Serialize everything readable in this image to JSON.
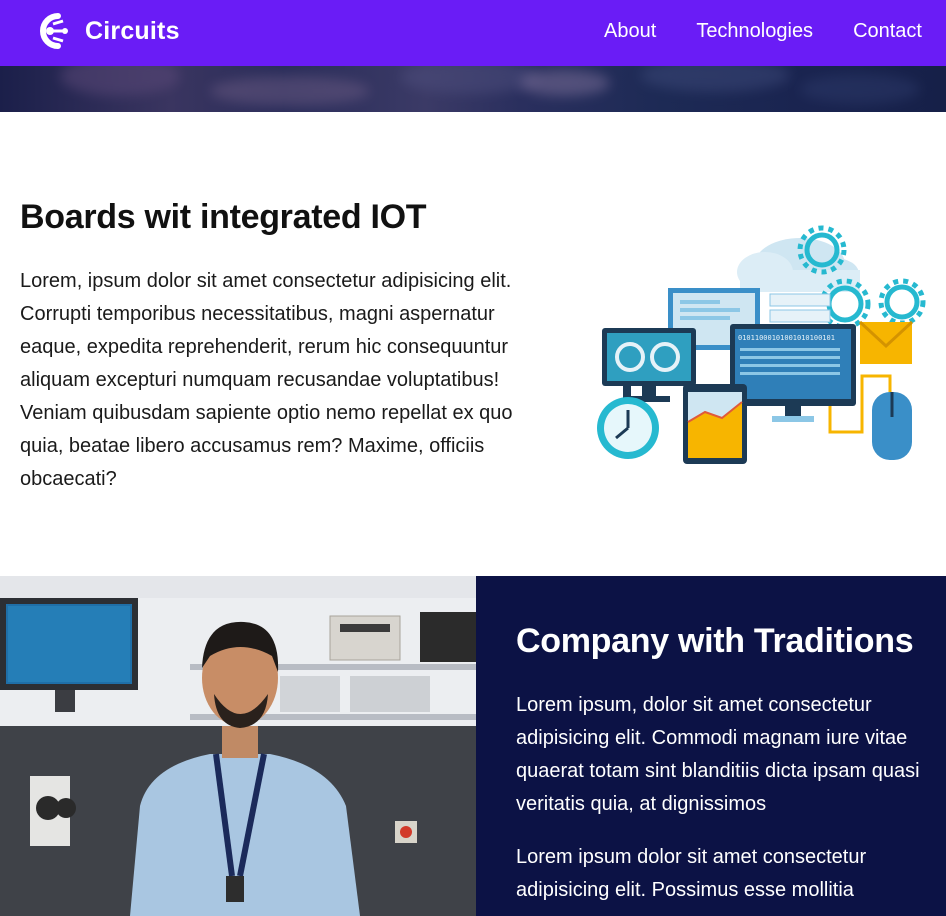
{
  "nav": {
    "brand": "Circuits",
    "links": [
      "About",
      "Technologies",
      "Contact"
    ]
  },
  "section_iot": {
    "title": "Boards wit integrated IOT",
    "text": "Lorem, ipsum dolor sit amet consectetur adipisicing elit. Corrupti temporibus necessitatibus, magni aspernatur eaque, expedita reprehenderit, rerum hic consequuntur aliquam excepturi numquam recusandae voluptatibus! Veniam quibusdam sapiente optio nemo repellat ex quo quia, beatae libero accusamus rem? Maxime, officiis obcaecati?",
    "illustration_binary": "01011000101001010100101"
  },
  "section_company": {
    "title": "Company with Traditions",
    "paragraph_1": "Lorem ipsum, dolor sit amet consectetur adipisicing elit. Commodi magnam iure vitae quaerat totam sint blanditiis dicta ipsam quasi veritatis quia, at dignissimos",
    "paragraph_2": "Lorem ipsum dolor sit amet consectetur adipisicing elit. Possimus esse mollitia"
  },
  "colors": {
    "nav_bg": "#6a1cf6",
    "dark_panel": "#0c1245",
    "accent_teal": "#26b9d0",
    "accent_yellow": "#f7b500"
  },
  "icons": {
    "brand_logo": "circuits-logo-icon"
  }
}
